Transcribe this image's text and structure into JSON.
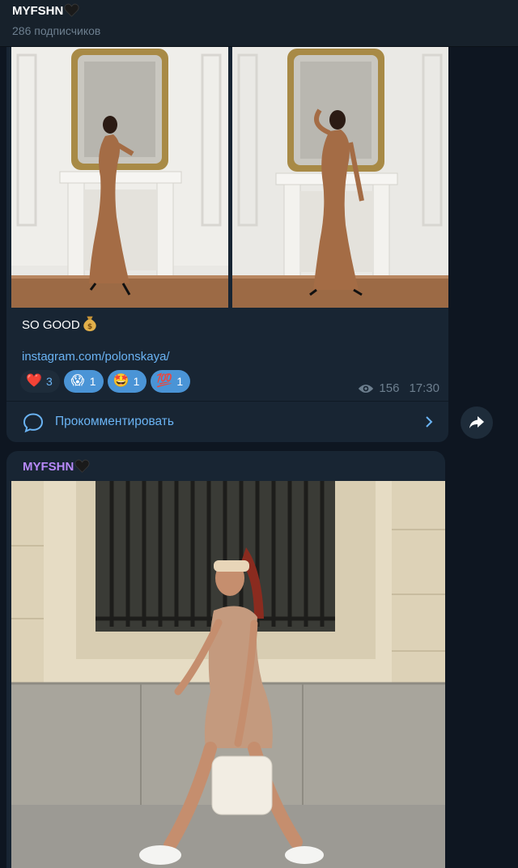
{
  "channel": {
    "name": "MYFSHN",
    "subscribers": "286 подписчиков"
  },
  "post1": {
    "caption": "SO GOOD",
    "caption_emoji": "money-bag",
    "link": "instagram.com/polonskaya/",
    "reactions": [
      {
        "emoji": "❤️",
        "count": "3",
        "chosen": true
      },
      {
        "emoji": "😱",
        "count": "1",
        "chosen": false
      },
      {
        "emoji": "🤩",
        "count": "1",
        "chosen": false
      },
      {
        "emoji": "💯",
        "count": "1",
        "chosen": false
      }
    ],
    "views": "156",
    "time": "17:30",
    "comment_label": "Прокомментировать"
  },
  "post2": {
    "author": "MYFSHN"
  },
  "colors": {
    "background": "#0e1621",
    "bubble": "#182533",
    "accent": "#6ab3f3",
    "author": "#b889fa"
  }
}
